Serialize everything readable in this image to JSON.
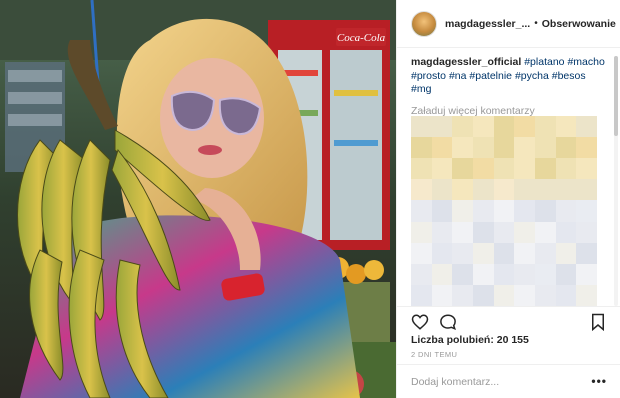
{
  "post": {
    "username": "magdagessler_...",
    "follow_label": "Obserwowanie",
    "caption_author": "magdagessler_official",
    "caption_tags": [
      "#platano",
      "#macho",
      "#prosto",
      "#na",
      "#patelnie",
      "#pycha",
      "#besos",
      "#mg"
    ],
    "load_more_label": "Załaduj więcej komentarzy",
    "likes_label": "Liczba polubień: 20 155",
    "date_label": "2 DNI TEMU",
    "comment_placeholder": "Dodaj komentarz...",
    "more_label": "•••"
  },
  "photo": {
    "sign_brand": "Coca-Cola"
  },
  "icons": {
    "like": "heart-icon",
    "comment": "comment-bubble-icon",
    "save": "bookmark-icon",
    "more": "more-options-icon"
  },
  "colors": {
    "hashtag": "#003569",
    "muted": "#999999",
    "border": "#efefef"
  }
}
